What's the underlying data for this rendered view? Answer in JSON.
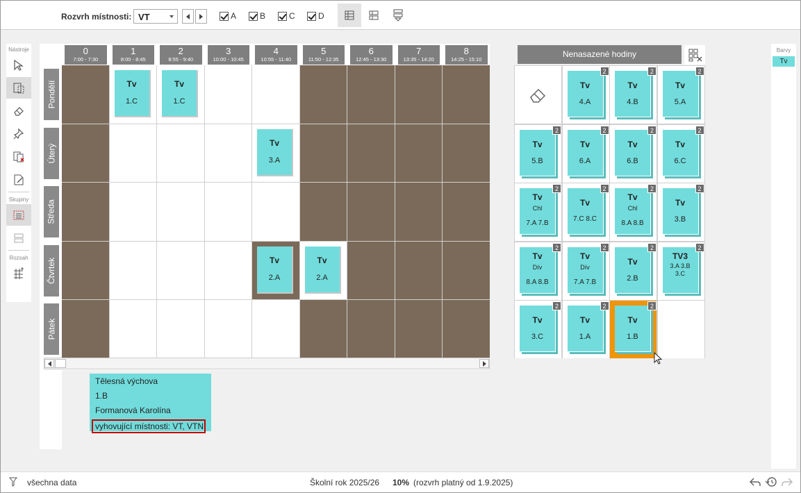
{
  "toolbar": {
    "room_label": "Rozvrh místnosti:",
    "room_value": "VT",
    "filters": [
      {
        "label": "A",
        "checked": true
      },
      {
        "label": "B",
        "checked": true
      },
      {
        "label": "C",
        "checked": true
      },
      {
        "label": "D",
        "checked": true
      }
    ]
  },
  "tools": {
    "section_tools": "Nástroje",
    "section_groups": "Skupiny",
    "section_range": "Rozsah"
  },
  "periods": [
    {
      "num": "0",
      "time": "7:00 - 7:30"
    },
    {
      "num": "1",
      "time": "8:00 - 8:45"
    },
    {
      "num": "2",
      "time": "8:55 - 9:40"
    },
    {
      "num": "3",
      "time": "10:00 - 10:45"
    },
    {
      "num": "4",
      "time": "10:55 - 11:40"
    },
    {
      "num": "5",
      "time": "11:50 - 12:35"
    },
    {
      "num": "6",
      "time": "12:45 - 13:30"
    },
    {
      "num": "7",
      "time": "13:35 - 14:20"
    },
    {
      "num": "8",
      "time": "14:25 - 15:10"
    }
  ],
  "days": [
    "Pondělí",
    "Úterý",
    "Středa",
    "Čtvrtek",
    "Pátek"
  ],
  "blocked": [
    [
      0,
      0
    ],
    [
      0,
      5
    ],
    [
      0,
      6
    ],
    [
      0,
      7
    ],
    [
      0,
      8
    ],
    [
      1,
      0
    ],
    [
      1,
      5
    ],
    [
      1,
      6
    ],
    [
      1,
      7
    ],
    [
      1,
      8
    ],
    [
      2,
      0
    ],
    [
      2,
      5
    ],
    [
      2,
      6
    ],
    [
      2,
      7
    ],
    [
      2,
      8
    ],
    [
      3,
      0
    ],
    [
      3,
      4
    ],
    [
      3,
      6
    ],
    [
      3,
      7
    ],
    [
      3,
      8
    ],
    [
      4,
      0
    ],
    [
      4,
      5
    ],
    [
      4,
      6
    ],
    [
      4,
      7
    ],
    [
      4,
      8
    ]
  ],
  "placed": [
    {
      "day": 0,
      "period": 1,
      "subject": "Tv",
      "class": "1.C"
    },
    {
      "day": 0,
      "period": 2,
      "subject": "Tv",
      "class": "1.C"
    },
    {
      "day": 1,
      "period": 4,
      "subject": "Tv",
      "class": "3.A"
    },
    {
      "day": 3,
      "period": 4,
      "subject": "Tv",
      "class": "2.A"
    },
    {
      "day": 3,
      "period": 5,
      "subject": "Tv",
      "class": "2.A"
    }
  ],
  "info": {
    "subject": "Tělesná výchova",
    "class": "1.B",
    "teacher": "Formanová Karolína",
    "rooms": "vyhovující místnosti: VT, VTN"
  },
  "unassigned": {
    "title": "Nenasazené hodiny",
    "cards": [
      {
        "subject": "Tv",
        "group": "",
        "classes": "4.A",
        "count": "2"
      },
      {
        "subject": "Tv",
        "group": "",
        "classes": "4.B",
        "count": "2"
      },
      {
        "subject": "Tv",
        "group": "",
        "classes": "5.A",
        "count": "2"
      },
      {
        "subject": "Tv",
        "group": "",
        "classes": "5.B",
        "count": "2"
      },
      {
        "subject": "Tv",
        "group": "",
        "classes": "6.A",
        "count": "2"
      },
      {
        "subject": "Tv",
        "group": "",
        "classes": "6.B",
        "count": "2"
      },
      {
        "subject": "Tv",
        "group": "",
        "classes": "6.C",
        "count": "2"
      },
      {
        "subject": "Tv",
        "group": "Chl",
        "classes": "7.A 7.B",
        "count": "2"
      },
      {
        "subject": "Tv",
        "group": "",
        "classes": "7.C 8.C",
        "count": "2"
      },
      {
        "subject": "Tv",
        "group": "Chl",
        "classes": "8.A 8.B",
        "count": "2"
      },
      {
        "subject": "Tv",
        "group": "",
        "classes": "3.B",
        "count": "2"
      },
      {
        "subject": "Tv",
        "group": "Dív",
        "classes": "8.A 8.B",
        "count": "2"
      },
      {
        "subject": "Tv",
        "group": "Dív",
        "classes": "7.A 7.B",
        "count": "2"
      },
      {
        "subject": "Tv",
        "group": "",
        "classes": "2.B",
        "count": "2"
      },
      {
        "subject": "TV3",
        "group": "",
        "classes": "3.A 3.B 3.C",
        "count": "2"
      },
      {
        "subject": "Tv",
        "group": "",
        "classes": "3.C",
        "count": "2"
      },
      {
        "subject": "Tv",
        "group": "",
        "classes": "1.A",
        "count": "2"
      },
      {
        "subject": "Tv",
        "group": "",
        "classes": "1.B",
        "count": "2",
        "selected": true
      }
    ]
  },
  "colors": {
    "title": "Barvy",
    "items": [
      "Tv"
    ],
    "accent": "#72dcdc",
    "blocked": "#7b6a59",
    "selected": "#f0940a"
  },
  "status": {
    "filter": "všechna data",
    "year": "Školní rok 2025/26",
    "percent": "10%",
    "validity": "(rozvrh platný od 1.9.2025)"
  }
}
